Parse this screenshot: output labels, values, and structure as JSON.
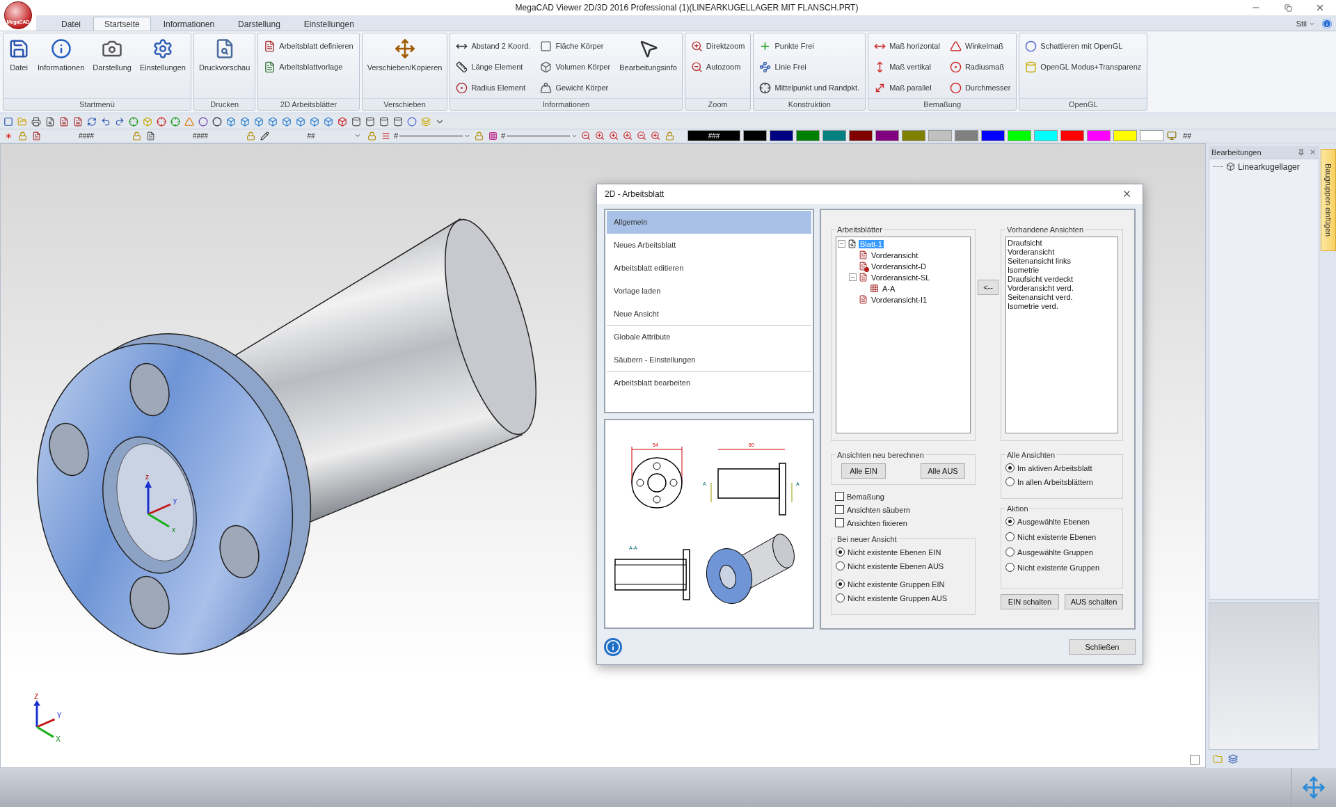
{
  "window": {
    "title": "MegaCAD Viewer 2D/3D 2016 Professional (1)(LINEARKUGELLAGER MIT FLANSCH.PRT)",
    "logo_text": "MegaCAD"
  },
  "menu_tabs": [
    {
      "label": "Datei",
      "selected": false
    },
    {
      "label": "Startseite",
      "selected": true
    },
    {
      "label": "Informationen",
      "selected": false
    },
    {
      "label": "Darstellung",
      "selected": false
    },
    {
      "label": "Einstellungen",
      "selected": false
    }
  ],
  "style_menu": {
    "label": "Stil"
  },
  "ribbon": [
    {
      "title": "Startmenü",
      "items": [
        {
          "label": "Datei",
          "kind": "large"
        },
        {
          "label": "Informationen",
          "kind": "large"
        },
        {
          "label": "Darstellung",
          "kind": "large"
        },
        {
          "label": "Einstellungen",
          "kind": "large"
        }
      ]
    },
    {
      "title": "Drucken",
      "items": [
        {
          "label": "Druckvorschau",
          "kind": "large"
        }
      ]
    },
    {
      "title": "2D Arbeitsblätter",
      "items": [
        {
          "label": "Arbeitsblatt definieren",
          "kind": "small"
        },
        {
          "label": "Arbeitsblattvorlage",
          "kind": "small"
        }
      ]
    },
    {
      "title": "Verschieben",
      "items": [
        {
          "label": "Verschieben/Kopieren",
          "kind": "large"
        }
      ]
    },
    {
      "title": "Informationen",
      "items": [
        {
          "label": "Abstand 2 Koord.",
          "kind": "small"
        },
        {
          "label": "Länge Element",
          "kind": "small"
        },
        {
          "label": "Radius Element",
          "kind": "small"
        },
        {
          "label": "Fläche Körper",
          "kind": "small"
        },
        {
          "label": "Volumen Körper",
          "kind": "small"
        },
        {
          "label": "Gewicht Körper",
          "kind": "small"
        },
        {
          "label": "Bearbeitungsinfo",
          "kind": "large"
        }
      ]
    },
    {
      "title": "Zoom",
      "items": [
        {
          "label": "Direktzoom",
          "kind": "small"
        },
        {
          "label": "Autozoom",
          "kind": "small"
        }
      ]
    },
    {
      "title": "Konstruktion",
      "items": [
        {
          "label": "Punkte Frei",
          "kind": "small"
        },
        {
          "label": "Linie Frei",
          "kind": "small"
        },
        {
          "label": "Mittelpunkt und Randpkt.",
          "kind": "small"
        }
      ]
    },
    {
      "title": "Bemaßung",
      "items": [
        {
          "label": "Maß horizontal",
          "kind": "small"
        },
        {
          "label": "Maß vertikal",
          "kind": "small"
        },
        {
          "label": "Maß parallel",
          "kind": "small"
        },
        {
          "label": "Winkelmaß",
          "kind": "small"
        },
        {
          "label": "Radiusmaß",
          "kind": "small"
        },
        {
          "label": "Durchmesser",
          "kind": "small"
        }
      ]
    },
    {
      "title": "OpenGL",
      "items": [
        {
          "label": "Schattieren mit OpenGL",
          "kind": "small"
        },
        {
          "label": "OpenGL Modus+Transparenz",
          "kind": "small"
        }
      ]
    }
  ],
  "toolbar_2": {
    "layer_fields": [
      "####",
      "####"
    ],
    "pen_field": "##",
    "line_fields": [
      "#",
      "#"
    ],
    "swatches": [
      {
        "color": "#000000",
        "label": "###"
      },
      {
        "color": "#000000"
      },
      {
        "color": "#000080"
      },
      {
        "color": "#008000"
      },
      {
        "color": "#008080"
      },
      {
        "color": "#800000"
      },
      {
        "color": "#800080"
      },
      {
        "color": "#808000"
      },
      {
        "color": "#c0c0c0"
      },
      {
        "color": "#808080"
      },
      {
        "color": "#0000ff"
      },
      {
        "color": "#00ff00"
      },
      {
        "color": "#00ffff"
      },
      {
        "color": "#ff0000"
      },
      {
        "color": "#ff00ff"
      },
      {
        "color": "#ffff00"
      },
      {
        "color": "#ffffff"
      }
    ],
    "end_label": "##"
  },
  "origin_triad": {
    "labels": [
      "z",
      "y",
      "x"
    ]
  },
  "corner_triad": {
    "labels": [
      "Z",
      "Y",
      "X"
    ]
  },
  "side_panel": {
    "title": "Bearbeitungen",
    "tree": [
      {
        "label": "Linearkugellager"
      }
    ],
    "tab": "Baugruppen einfügen"
  },
  "dialog": {
    "title": "2D - Arbeitsblatt",
    "nav": [
      {
        "label": "Allgemein",
        "selected": true,
        "divider_after": false
      },
      {
        "label": "Neues Arbeitsblatt",
        "selected": false,
        "divider_after": false
      },
      {
        "label": "Arbeitsblatt editieren",
        "selected": false,
        "divider_after": false
      },
      {
        "label": "Vorlage laden",
        "selected": false,
        "divider_after": false
      },
      {
        "label": "Neue Ansicht",
        "selected": false,
        "divider_after": true
      },
      {
        "label": "Globale Attribute",
        "selected": false,
        "divider_after": false
      },
      {
        "label": "Säubern - Einstellungen",
        "selected": false,
        "divider_after": true
      },
      {
        "label": "Arbeitsblatt bearbeiten",
        "selected": false,
        "divider_after": false
      }
    ],
    "preview": {
      "labels": [
        "54",
        "80",
        "A",
        "A",
        "A-A"
      ]
    },
    "sheets": {
      "title": "Arbeitsblätter",
      "tree": [
        {
          "label": "Blatt-1",
          "kind": "sheet",
          "selected": true,
          "expanded": true,
          "children": [
            {
              "label": "Vorderansicht",
              "kind": "view",
              "selected": false
            },
            {
              "label": "Vorderansicht-D",
              "kind": "view_deleted",
              "selected": false
            },
            {
              "label": "Vorderansicht-SL",
              "kind": "view",
              "selected": false,
              "expanded": true,
              "children": [
                {
                  "label": "A-A",
                  "kind": "section",
                  "selected": false
                }
              ]
            },
            {
              "label": "Vorderansicht-I1",
              "kind": "view",
              "selected": false
            }
          ]
        }
      ]
    },
    "transfer_button": "<--",
    "views": {
      "title": "Vorhandene Ansichten",
      "items": [
        "Draufsicht",
        "Vorderansicht",
        "Seitenansicht links",
        "Isometrie",
        "Draufsicht verdeckt",
        "Vorderansicht verd.",
        "Seitenansicht verd.",
        "Isometrie verd."
      ]
    },
    "recalc": {
      "title": "Ansichten neu berechnen",
      "buttons": [
        "Alle EIN",
        "Alle AUS"
      ]
    },
    "options": [
      {
        "label": "Bemaßung",
        "checked": false
      },
      {
        "label": "Ansichten säubern",
        "checked": false
      },
      {
        "label": "Ansichten fixieren",
        "checked": false
      }
    ],
    "new_view": {
      "title": "Bei neuer Ansicht",
      "groups": [
        [
          {
            "label": "Nicht existente Ebenen EIN",
            "selected": true
          },
          {
            "label": "Nicht existente Ebenen AUS",
            "selected": false
          }
        ],
        [
          {
            "label": "Nicht existente Gruppen EIN",
            "selected": true
          },
          {
            "label": "Nicht existente Gruppen AUS",
            "selected": false
          }
        ]
      ]
    },
    "all_views": {
      "title": "Alle Ansichten",
      "options": [
        {
          "label": "Im aktiven Arbeitsblatt",
          "selected": true
        },
        {
          "label": "In allen Arbeitsblättern",
          "selected": false
        }
      ]
    },
    "action": {
      "title": "Aktion",
      "options": [
        {
          "label": "Ausgewählte Ebenen",
          "selected": true
        },
        {
          "label": "Nicht existente Ebenen",
          "selected": false
        },
        {
          "label": "Ausgewählte Gruppen",
          "selected": false
        },
        {
          "label": "Nicht existente Gruppen",
          "selected": false
        }
      ],
      "buttons": [
        "EIN schalten",
        "AUS schalten"
      ]
    },
    "close_button": "Schließen"
  }
}
